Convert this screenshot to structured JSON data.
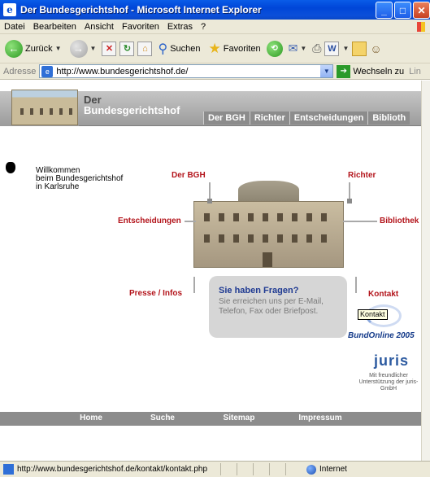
{
  "window": {
    "title": "Der Bundesgerichtshof - Microsoft Internet Explorer",
    "buttons": {
      "minimize": "_",
      "maximize": "□",
      "close": "✕"
    }
  },
  "menu": [
    "Datei",
    "Bearbeiten",
    "Ansicht",
    "Favoriten",
    "Extras",
    "?"
  ],
  "toolbar": {
    "back": "Zurück",
    "search": "Suchen",
    "favorites": "Favoriten"
  },
  "address": {
    "label": "Adresse",
    "url": "http://www.bundesgerichtshof.de/",
    "go": "Wechseln zu",
    "links": "Lin"
  },
  "banner": {
    "title_line1": "Der",
    "title_line2": "Bundesgerichtshof",
    "tabs": [
      "Der BGH",
      "Richter",
      "Entscheidungen",
      "Biblioth"
    ]
  },
  "welcome": [
    "Willkommen",
    "beim Bundesgerichtshof",
    "in Karlsruhe"
  ],
  "nav_links": {
    "der_bgh": "Der BGH",
    "richter": "Richter",
    "entscheidungen": "Entscheidungen",
    "bibliothek": "Bibliothek",
    "presse": "Presse / Infos",
    "kontakt": "Kontakt"
  },
  "question": {
    "title": "Sie haben Fragen?",
    "text": "Sie erreichen uns per E-Mail, Telefon, Fax oder Briefpost."
  },
  "tooltip": "Kontakt",
  "bundonline": "BundOnline 2005",
  "juris": {
    "logo": "juris",
    "sub": "Mit freundlicher Unterstützung der juris-GmbH"
  },
  "footer": [
    "Home",
    "Suche",
    "Sitemap",
    "Impressum"
  ],
  "status": {
    "url": "http://www.bundesgerichtshof.de/kontakt/kontakt.php",
    "zone": "Internet"
  }
}
